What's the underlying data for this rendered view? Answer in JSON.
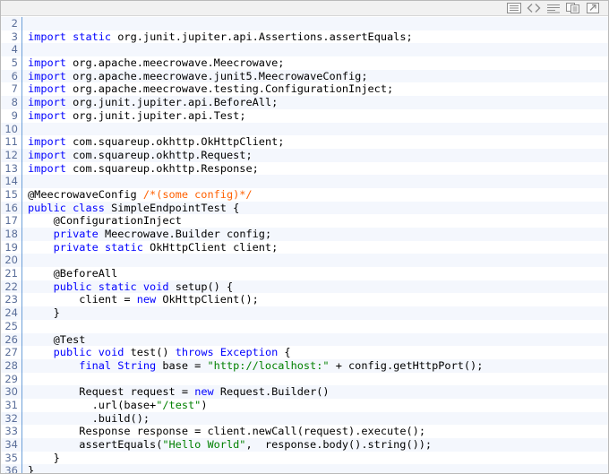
{
  "toolbar": {
    "buttons": [
      {
        "icon": "view-source-icon"
      },
      {
        "icon": "code-brackets-icon"
      },
      {
        "icon": "wrap-lines-icon"
      },
      {
        "icon": "copy-icon"
      },
      {
        "icon": "popout-icon"
      }
    ]
  },
  "code": {
    "lines": [
      {
        "n": "2",
        "t": ""
      },
      {
        "n": "3",
        "t": "import static org.junit.jupiter.api.Assertions.assertEquals;"
      },
      {
        "n": "4",
        "t": ""
      },
      {
        "n": "5",
        "t": "import org.apache.meecrowave.Meecrowave;"
      },
      {
        "n": "6",
        "t": "import org.apache.meecrowave.junit5.MeecrowaveConfig;"
      },
      {
        "n": "7",
        "t": "import org.apache.meecrowave.testing.ConfigurationInject;"
      },
      {
        "n": "8",
        "t": "import org.junit.jupiter.api.BeforeAll;"
      },
      {
        "n": "9",
        "t": "import org.junit.jupiter.api.Test;"
      },
      {
        "n": "10",
        "t": ""
      },
      {
        "n": "11",
        "t": "import com.squareup.okhttp.OkHttpClient;"
      },
      {
        "n": "12",
        "t": "import com.squareup.okhttp.Request;"
      },
      {
        "n": "13",
        "t": "import com.squareup.okhttp.Response;"
      },
      {
        "n": "14",
        "t": ""
      },
      {
        "n": "15",
        "t": "@MeecrowaveConfig /*(some config)*/"
      },
      {
        "n": "16",
        "t": "public class SimpleEndpointTest {"
      },
      {
        "n": "17",
        "t": "    @ConfigurationInject"
      },
      {
        "n": "18",
        "t": "    private Meecrowave.Builder config;"
      },
      {
        "n": "19",
        "t": "    private static OkHttpClient client;"
      },
      {
        "n": "20",
        "t": ""
      },
      {
        "n": "21",
        "t": "    @BeforeAll"
      },
      {
        "n": "22",
        "t": "    public static void setup() {"
      },
      {
        "n": "23",
        "t": "        client = new OkHttpClient();"
      },
      {
        "n": "24",
        "t": "    }"
      },
      {
        "n": "25",
        "t": ""
      },
      {
        "n": "26",
        "t": "    @Test"
      },
      {
        "n": "27",
        "t": "    public void test() throws Exception {"
      },
      {
        "n": "28",
        "t": "        final String base = \"http://localhost:\" + config.getHttpPort();"
      },
      {
        "n": "29",
        "t": ""
      },
      {
        "n": "30",
        "t": "        Request request = new Request.Builder()"
      },
      {
        "n": "31",
        "t": "          .url(base+\"/test\")"
      },
      {
        "n": "32",
        "t": "          .build();"
      },
      {
        "n": "33",
        "t": "        Response response = client.newCall(request).execute();"
      },
      {
        "n": "34",
        "t": "        assertEquals(\"Hello World\",  response.body().string());"
      },
      {
        "n": "35",
        "t": "    }"
      },
      {
        "n": "36",
        "t": "}"
      }
    ]
  },
  "colors": {
    "keyword": "#0000ff",
    "string": "#008000",
    "comment": "#ff6000",
    "line_number": "#5b6f9a",
    "gutter_border": "#6da0d8",
    "alt_row": "#f4f7fd"
  }
}
